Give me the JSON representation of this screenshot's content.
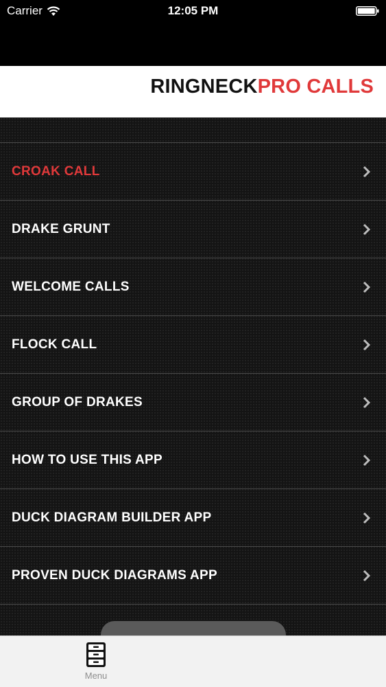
{
  "status_bar": {
    "carrier": "Carrier",
    "time": "12:05 PM"
  },
  "header": {
    "title_dark": "RINGNECK",
    "title_red": "PRO CALLS"
  },
  "menu": {
    "items": [
      {
        "label": "CROAK CALL",
        "active": true
      },
      {
        "label": "DRAKE GRUNT",
        "active": false
      },
      {
        "label": "WELCOME CALLS",
        "active": false
      },
      {
        "label": "FLOCK CALL",
        "active": false
      },
      {
        "label": "GROUP OF DRAKES",
        "active": false
      },
      {
        "label": "HOW TO USE THIS APP",
        "active": false
      },
      {
        "label": "DUCK DIAGRAM BUILDER APP",
        "active": false
      },
      {
        "label": "PROVEN DUCK DIAGRAMS APP",
        "active": false
      }
    ]
  },
  "tab_bar": {
    "menu_label": "Menu"
  },
  "colors": {
    "accent_red": "#e0393a",
    "list_background": "#141414",
    "tab_bar_background": "#f2f2f2"
  },
  "icons": [
    "wifi-icon",
    "battery-icon",
    "chevron-right-icon",
    "file-cabinet-icon"
  ]
}
